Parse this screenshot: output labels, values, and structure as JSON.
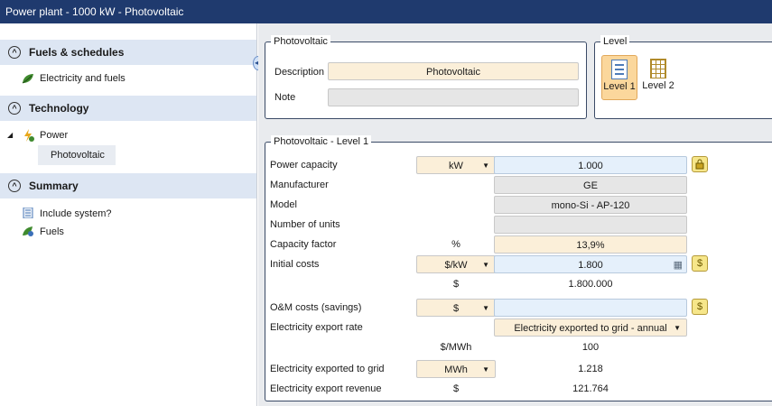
{
  "window": {
    "title": "Power plant - 1000 kW - Photovoltaic"
  },
  "sidebar": {
    "sections": [
      {
        "label": "Fuels & schedules",
        "toggle": "^"
      },
      {
        "label": "Technology",
        "toggle": "^"
      },
      {
        "label": "Summary",
        "toggle": "^"
      }
    ],
    "items": {
      "electricity_and_fuels": "Electricity and fuels",
      "power": "Power",
      "tree_expander": "◢",
      "photovoltaic": "Photovoltaic",
      "include_system": "Include system?",
      "fuels": "Fuels"
    },
    "splitter_glyph": "◂▸"
  },
  "photovoltaic_group": {
    "title": "Photovoltaic",
    "description_label": "Description",
    "description_value": "Photovoltaic",
    "note_label": "Note",
    "note_value": ""
  },
  "level_group": {
    "title": "Level",
    "level1_label": "Level 1",
    "level2_label": "Level 2"
  },
  "level1_group": {
    "title": "Photovoltaic - Level 1",
    "rows": {
      "power_capacity": {
        "label": "Power capacity",
        "unit": "kW",
        "value": "1.000"
      },
      "manufacturer": {
        "label": "Manufacturer",
        "value": "GE"
      },
      "model": {
        "label": "Model",
        "value": "mono-Si - AP-120"
      },
      "number_of_units": {
        "label": "Number of units",
        "value": ""
      },
      "capacity_factor": {
        "label": "Capacity factor",
        "unit": "%",
        "value": "13,9%"
      },
      "initial_costs": {
        "label": "Initial costs",
        "unit": "$/kW",
        "value": "1.800",
        "unit2": "$",
        "value2": "1.800.000"
      },
      "om_costs": {
        "label": "O&M costs (savings)",
        "unit": "$",
        "value": ""
      },
      "export_rate": {
        "label": "Electricity export rate",
        "selection": "Electricity exported to grid - annual",
        "unit": "$/MWh",
        "value": "100"
      },
      "exported_to_grid": {
        "label": "Electricity exported to grid",
        "unit": "MWh",
        "value": "1.218"
      },
      "export_revenue": {
        "label": "Electricity export revenue",
        "unit": "$",
        "value": "121.764"
      }
    },
    "dropdown_arrow": "▼"
  },
  "icons": {
    "lock": "🔒",
    "dollar": "$",
    "calc": "▦"
  }
}
